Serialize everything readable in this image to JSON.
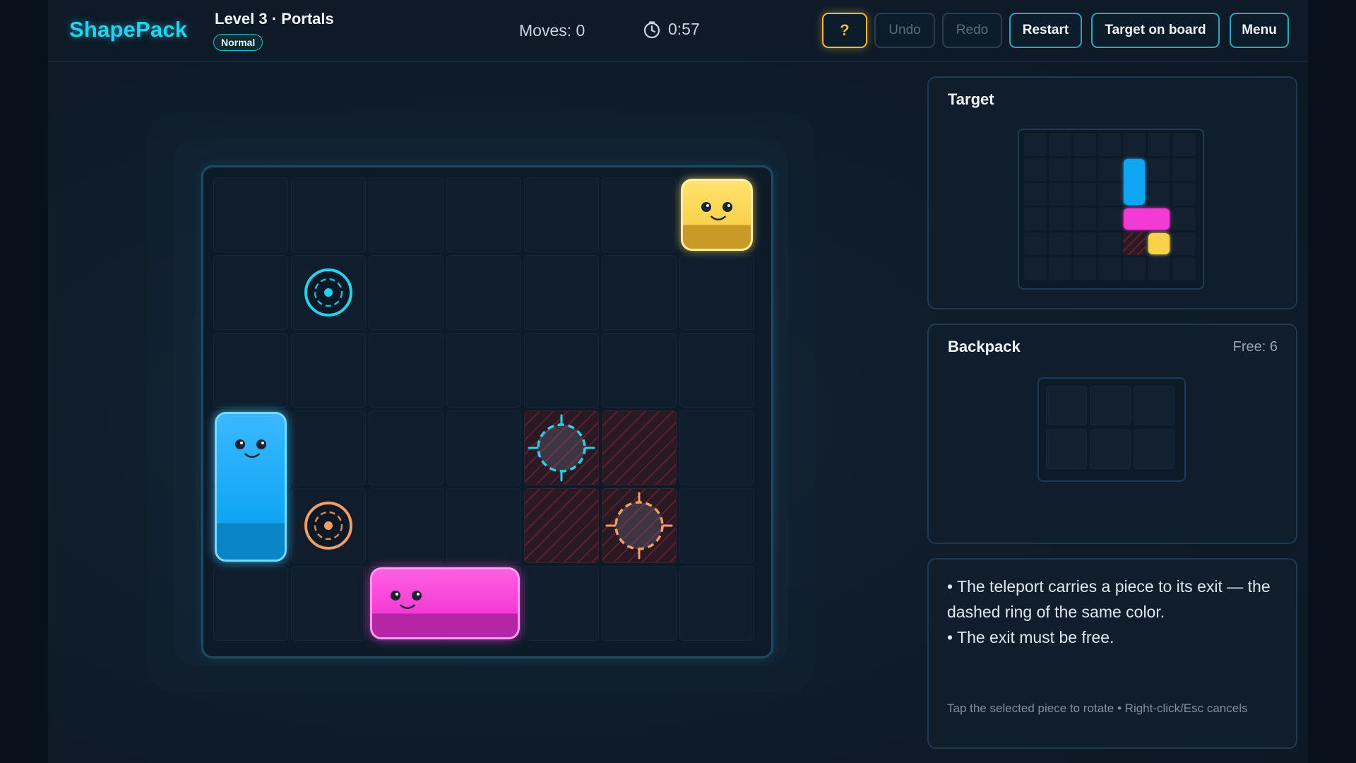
{
  "app": {
    "name": "ShapePack"
  },
  "level": {
    "title": "Level 3 · Portals",
    "difficulty": "Normal"
  },
  "stats": {
    "moves": "Moves: 0",
    "timer": "0:57"
  },
  "toolbar": {
    "help": "?",
    "undo": "Undo",
    "redo": "Redo",
    "restart": "Restart",
    "target_on_board": "Target on board",
    "menu": "Menu"
  },
  "board": {
    "cols": 7,
    "rows": 6,
    "blocked_cells": [
      [
        3,
        4
      ],
      [
        3,
        5
      ],
      [
        4,
        4
      ],
      [
        4,
        5
      ]
    ],
    "portals": [
      {
        "color": "#22d3ee",
        "entry": [
          1,
          1
        ],
        "exit": [
          3,
          4
        ]
      },
      {
        "color": "#f59e63",
        "entry": [
          4,
          1
        ],
        "exit": [
          4,
          5
        ]
      }
    ],
    "pieces": [
      {
        "name": "yellow-piece",
        "color": "#f8d24a",
        "cells": [
          [
            0,
            6
          ]
        ]
      },
      {
        "name": "blue-piece",
        "color": "#0ea5f4",
        "cells": [
          [
            3,
            0
          ],
          [
            4,
            0
          ]
        ]
      },
      {
        "name": "pink-piece",
        "color": "#f43ad4",
        "cells": [
          [
            5,
            2
          ],
          [
            5,
            3
          ]
        ]
      }
    ]
  },
  "target": {
    "title": "Target",
    "cols": 7,
    "rows": 6,
    "pieces": [
      {
        "color": "#0ea5f4",
        "cells": [
          [
            1,
            4
          ],
          [
            2,
            4
          ]
        ]
      },
      {
        "color": "#f43ad4",
        "cells": [
          [
            3,
            4
          ],
          [
            3,
            5
          ]
        ]
      },
      {
        "color": "#f8d24a",
        "cells": [
          [
            4,
            5
          ]
        ]
      }
    ],
    "blocked_cells": [
      [
        4,
        4
      ]
    ]
  },
  "backpack": {
    "title": "Backpack",
    "free": "Free: 6",
    "cols": 3,
    "rows": 2
  },
  "hints": {
    "line1": "• The teleport carries a piece to its exit — the dashed ring of the same color.",
    "line2": "• The exit must be free.",
    "footer": "Tap the selected piece to rotate • Right-click/Esc cancels"
  },
  "icons": {
    "timer": "clock-icon",
    "portal_entry": "portal-entry-icon",
    "portal_exit": "portal-exit-icon"
  }
}
